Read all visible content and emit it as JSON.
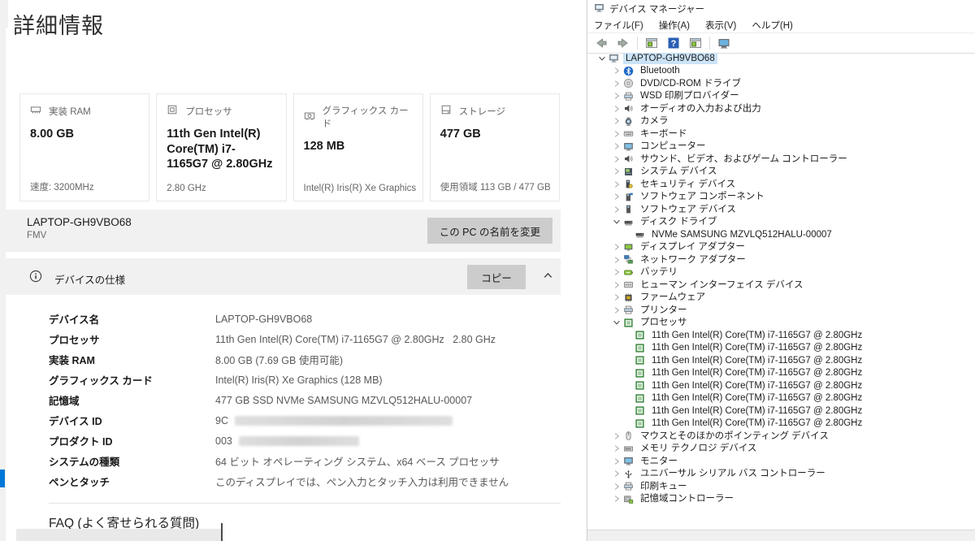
{
  "settings": {
    "page_title": "詳細情報",
    "cards": [
      {
        "icon": "ram",
        "label": "実装 RAM",
        "value": "8.00 GB",
        "footer": "速度: 3200MHz"
      },
      {
        "icon": "cpu",
        "label": "プロセッサ",
        "value": "11th Gen Intel(R) Core(TM) i7-1165G7 @ 2.80GHz",
        "footer": "2.80 GHz"
      },
      {
        "icon": "gpu",
        "label": "グラフィックス カード",
        "value": "128 MB",
        "footer": "Intel(R) Iris(R) Xe Graphics"
      },
      {
        "icon": "storage",
        "label": "ストレージ",
        "value": "477 GB",
        "footer": "使用領域 113 GB / 477 GB"
      }
    ],
    "device_name_bar": {
      "name": "LAPTOP-GH9VBO68",
      "subtitle": "FMV",
      "rename_button": "この PC の名前を変更"
    },
    "device_spec": {
      "title": "デバイスの仕様",
      "copy_button": "コピー"
    },
    "spec_rows": [
      {
        "label": "デバイス名",
        "value": "LAPTOP-GH9VBO68"
      },
      {
        "label": "プロセッサ",
        "value": "11th Gen Intel(R) Core(TM) i7-1165G7 @ 2.80GHz   2.80 GHz"
      },
      {
        "label": "実装 RAM",
        "value": "8.00 GB (7.69 GB 使用可能)"
      },
      {
        "label": "グラフィックス カード",
        "value": "Intel(R) Iris(R) Xe Graphics (128 MB)"
      },
      {
        "label": "記憶域",
        "value": "477 GB SSD NVMe SAMSUNG MZVLQ512HALU-00007"
      },
      {
        "label": "デバイス ID",
        "value": "9C",
        "redacted": true,
        "redact_width": 268
      },
      {
        "label": "プロダクト ID",
        "value": "003",
        "redacted": true,
        "redact_width": 148
      },
      {
        "label": "システムの種類",
        "value": "64 ビット オペレーティング システム、x64 ベース プロセッサ"
      },
      {
        "label": "ペンとタッチ",
        "value": "このディスプレイでは、ペン入力とタッチ入力は利用できません"
      }
    ],
    "faq_title": "FAQ (よく寄せられる質問)"
  },
  "device_manager": {
    "window_title": "デバイス マネージャー",
    "menu_items": [
      "ファイル(F)",
      "操作(A)",
      "表示(V)",
      "ヘルプ(H)"
    ],
    "toolbar_icons": [
      "back-arrow",
      "forward-arrow",
      "separator",
      "console-window",
      "help",
      "console-window",
      "separator",
      "remote-desktop"
    ],
    "tree": [
      {
        "level": 0,
        "expand": "expanded",
        "icon": "computer",
        "label": "LAPTOP-GH9VBO68",
        "selected": true
      },
      {
        "level": 1,
        "expand": "collapsed",
        "icon": "bluetooth",
        "label": "Bluetooth"
      },
      {
        "level": 1,
        "expand": "collapsed",
        "icon": "disc",
        "label": "DVD/CD-ROM ドライブ"
      },
      {
        "level": 1,
        "expand": "collapsed",
        "icon": "printer",
        "label": "WSD 印刷プロバイダー"
      },
      {
        "level": 1,
        "expand": "collapsed",
        "icon": "audio",
        "label": "オーディオの入力および出力"
      },
      {
        "level": 1,
        "expand": "collapsed",
        "icon": "camera",
        "label": "カメラ"
      },
      {
        "level": 1,
        "expand": "collapsed",
        "icon": "keyboard",
        "label": "キーボード"
      },
      {
        "level": 1,
        "expand": "collapsed",
        "icon": "monitor",
        "label": "コンピューター"
      },
      {
        "level": 1,
        "expand": "collapsed",
        "icon": "audio",
        "label": "サウンド、ビデオ、およびゲーム コントローラー"
      },
      {
        "level": 1,
        "expand": "collapsed",
        "icon": "system",
        "label": "システム デバイス"
      },
      {
        "level": 1,
        "expand": "collapsed",
        "icon": "security",
        "label": "セキュリティ デバイス"
      },
      {
        "level": 1,
        "expand": "collapsed",
        "icon": "component",
        "label": "ソフトウェア コンポーネント"
      },
      {
        "level": 1,
        "expand": "collapsed",
        "icon": "softdevice",
        "label": "ソフトウェア デバイス"
      },
      {
        "level": 1,
        "expand": "expanded",
        "icon": "disk",
        "label": "ディスク ドライブ"
      },
      {
        "level": 2,
        "expand": "none",
        "icon": "disk",
        "label": "NVMe SAMSUNG MZVLQ512HALU-00007"
      },
      {
        "level": 1,
        "expand": "collapsed",
        "icon": "display",
        "label": "ディスプレイ アダプター"
      },
      {
        "level": 1,
        "expand": "collapsed",
        "icon": "network",
        "label": "ネットワーク アダプター"
      },
      {
        "level": 1,
        "expand": "collapsed",
        "icon": "battery",
        "label": "バッテリ"
      },
      {
        "level": 1,
        "expand": "collapsed",
        "icon": "hid",
        "label": "ヒューマン インターフェイス デバイス"
      },
      {
        "level": 1,
        "expand": "collapsed",
        "icon": "firmware",
        "label": "ファームウェア"
      },
      {
        "level": 1,
        "expand": "collapsed",
        "icon": "printer",
        "label": "プリンター"
      },
      {
        "level": 1,
        "expand": "expanded",
        "icon": "cpu",
        "label": "プロセッサ"
      },
      {
        "level": 2,
        "expand": "none",
        "icon": "cpu",
        "label": "11th Gen Intel(R) Core(TM) i7-1165G7 @ 2.80GHz"
      },
      {
        "level": 2,
        "expand": "none",
        "icon": "cpu",
        "label": "11th Gen Intel(R) Core(TM) i7-1165G7 @ 2.80GHz"
      },
      {
        "level": 2,
        "expand": "none",
        "icon": "cpu",
        "label": "11th Gen Intel(R) Core(TM) i7-1165G7 @ 2.80GHz"
      },
      {
        "level": 2,
        "expand": "none",
        "icon": "cpu",
        "label": "11th Gen Intel(R) Core(TM) i7-1165G7 @ 2.80GHz"
      },
      {
        "level": 2,
        "expand": "none",
        "icon": "cpu",
        "label": "11th Gen Intel(R) Core(TM) i7-1165G7 @ 2.80GHz"
      },
      {
        "level": 2,
        "expand": "none",
        "icon": "cpu",
        "label": "11th Gen Intel(R) Core(TM) i7-1165G7 @ 2.80GHz"
      },
      {
        "level": 2,
        "expand": "none",
        "icon": "cpu",
        "label": "11th Gen Intel(R) Core(TM) i7-1165G7 @ 2.80GHz"
      },
      {
        "level": 2,
        "expand": "none",
        "icon": "cpu",
        "label": "11th Gen Intel(R) Core(TM) i7-1165G7 @ 2.80GHz"
      },
      {
        "level": 1,
        "expand": "collapsed",
        "icon": "mouse",
        "label": "マウスとそのほかのポインティング デバイス"
      },
      {
        "level": 1,
        "expand": "collapsed",
        "icon": "memory",
        "label": "メモリ テクノロジ デバイス"
      },
      {
        "level": 1,
        "expand": "collapsed",
        "icon": "monitor",
        "label": "モニター"
      },
      {
        "level": 1,
        "expand": "collapsed",
        "icon": "usb",
        "label": "ユニバーサル シリアル バス コントローラー"
      },
      {
        "level": 1,
        "expand": "collapsed",
        "icon": "printer",
        "label": "印刷キュー"
      },
      {
        "level": 1,
        "expand": "collapsed",
        "icon": "storage-ctrl",
        "label": "記憶域コントローラー"
      }
    ]
  },
  "colors": {
    "accent": "#0078d7",
    "selection": "#cbe3f7",
    "bar_gray": "#f1f1f1",
    "button_gray": "#cccccc"
  }
}
